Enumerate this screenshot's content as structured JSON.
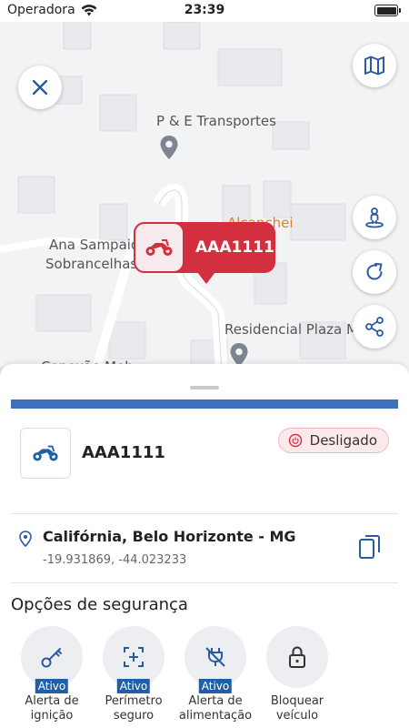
{
  "status_bar": {
    "carrier": "Operadora",
    "time": "23:39"
  },
  "map": {
    "labels": {
      "transportes": "P & E Transportes",
      "alcancei": "Alcançhei",
      "ana_line1": "Ana Sampaio",
      "ana_line2": "Sobrancelhas",
      "residencial": "Residencial Plaza M",
      "bottom": "Conexão Mob"
    },
    "marker": {
      "plate": "AAA1111"
    }
  },
  "sheet": {
    "progress_percent": 100,
    "vehicle": {
      "plate": "AAA1111",
      "status": "Desligado"
    },
    "address": {
      "title": "Califórnia, Belo Horizonte - MG",
      "coords": "-19.931869, -44.023233"
    },
    "security_title": "Opções de segurança",
    "options": [
      {
        "line1": "Alerta de",
        "line2": "ignição",
        "badge": "Ativo"
      },
      {
        "line1": "Perímetro",
        "line2": "seguro",
        "badge": "Ativo"
      },
      {
        "line1": "Alerta de",
        "line2": "alimentação",
        "badge": "Ativo"
      },
      {
        "line1": "Bloquear",
        "line2": "veículo",
        "badge": ""
      }
    ]
  },
  "colors": {
    "accent": "#d32f3f",
    "blue": "#1f5fa8",
    "progress": "#3f6fbf"
  },
  "icons": [
    "wifi-icon",
    "battery-icon",
    "close-icon",
    "map-icon",
    "street-view-icon",
    "refresh-icon",
    "share-icon",
    "motorcycle-icon",
    "power-icon",
    "location-pin-icon",
    "copy-icon",
    "key-icon",
    "perimeter-icon",
    "plug-off-icon",
    "lock-icon"
  ]
}
